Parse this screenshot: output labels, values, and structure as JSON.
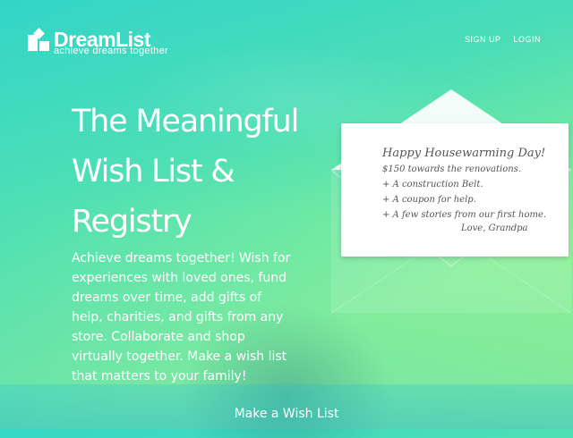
{
  "brand": {
    "name": "DreamList",
    "tagline": "achieve dreams together",
    "logo_icon": "squares-logo-icon"
  },
  "nav": {
    "signup_label": "SIGN UP",
    "login_label": "LOGIN"
  },
  "hero": {
    "title_lines": [
      "The Meaningful",
      "Wish List &",
      "Registry"
    ],
    "description": "Achieve dreams together! Wish for experiences with loved ones, fund dreams over time, add gifts of help, charities, and gifts from any store. Collaborate and shop virtually together. Make a wish list that matters to your family!"
  },
  "card": {
    "title": "Happy Housewarming Day!",
    "lines": [
      "$150 towards the renovations.",
      "+ A construction Belt.",
      "+ A coupon for help.",
      "+ A few stories from our first home."
    ],
    "signature": "Love, Grandpa"
  },
  "cta": {
    "label": "Make a Wish List"
  },
  "colors": {
    "gradient_start": "#35d7c6",
    "gradient_end": "#9cf58a",
    "text": "#ffffff",
    "card_text": "#555555"
  }
}
